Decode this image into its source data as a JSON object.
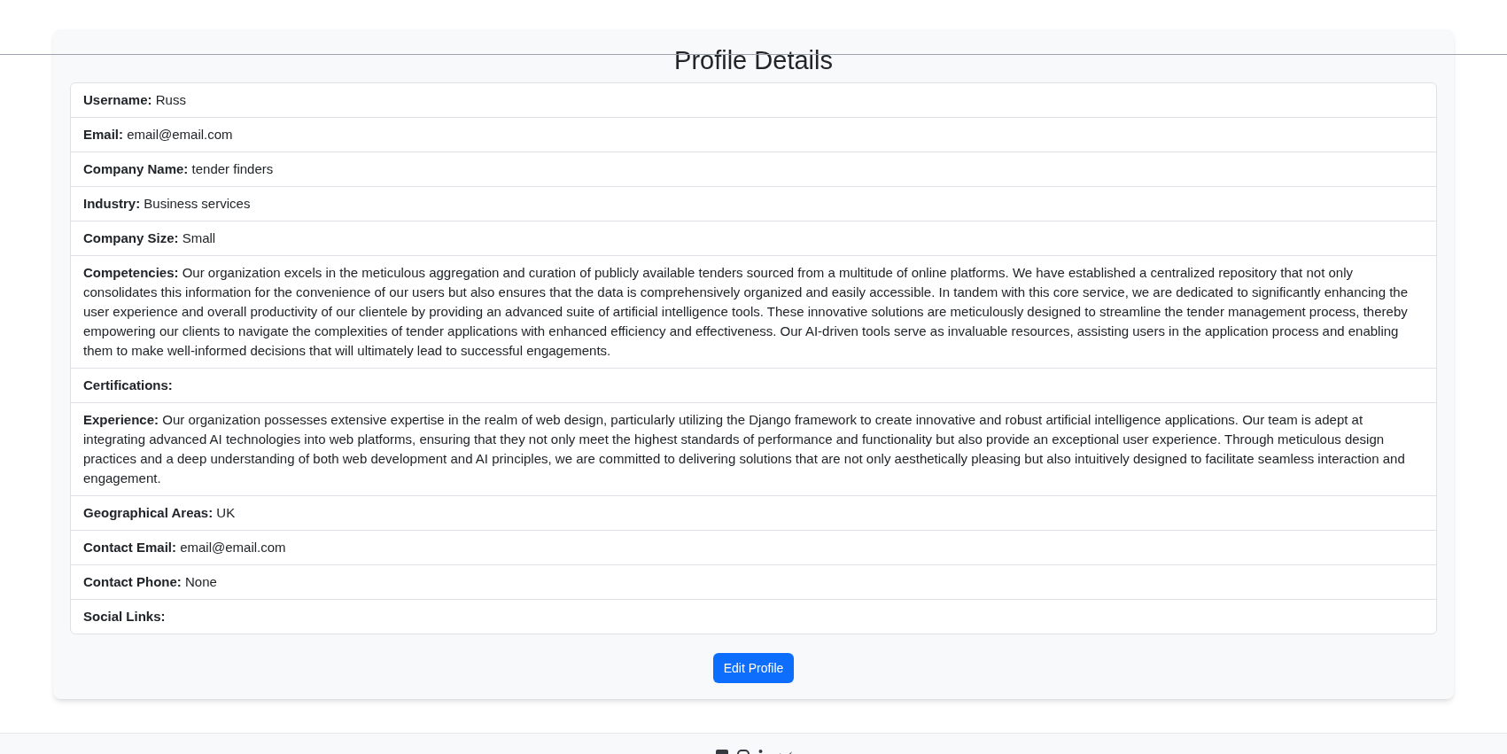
{
  "title": "Profile Details",
  "fields": [
    {
      "label": "Username:",
      "value": "Russ"
    },
    {
      "label": "Email:",
      "value": "email@email.com"
    },
    {
      "label": "Company Name:",
      "value": "tender finders"
    },
    {
      "label": "Industry:",
      "value": "Business services"
    },
    {
      "label": "Company Size:",
      "value": "Small"
    },
    {
      "label": "Competencies:",
      "value": "Our organization excels in the meticulous aggregation and curation of publicly available tenders sourced from a multitude of online platforms. We have established a centralized repository that not only consolidates this information for the convenience of our users but also ensures that the data is comprehensively organized and easily accessible. In tandem with this core service, we are dedicated to significantly enhancing the user experience and overall productivity of our clientele by providing an advanced suite of artificial intelligence tools. These innovative solutions are meticulously designed to streamline the tender management process, thereby empowering our clients to navigate the complexities of tender applications with enhanced efficiency and effectiveness. Our AI-driven tools serve as invaluable resources, assisting users in the application process and enabling them to make well-informed decisions that will ultimately lead to successful engagements."
    },
    {
      "label": "Certifications:"
    },
    {
      "label": "Experience:",
      "value": "Our organization possesses extensive expertise in the realm of web design, particularly utilizing the Django framework to create innovative and robust artificial intelligence applications. Our team is adept at integrating advanced AI technologies into web platforms, ensuring that they not only meet the highest standards of performance and functionality but also provide an exceptional user experience. Through meticulous design practices and a deep understanding of both web development and AI principles, we are committed to delivering solutions that are not only aesthetically pleasing but also intuitively designed to facilitate seamless interaction and engagement."
    },
    {
      "label": "Geographical Areas:",
      "value": "UK"
    },
    {
      "label": "Contact Email:",
      "value": "email@email.com"
    },
    {
      "label": "Contact Phone:",
      "value": "None"
    },
    {
      "label": "Social Links:"
    }
  ],
  "button": "Edit Profile"
}
